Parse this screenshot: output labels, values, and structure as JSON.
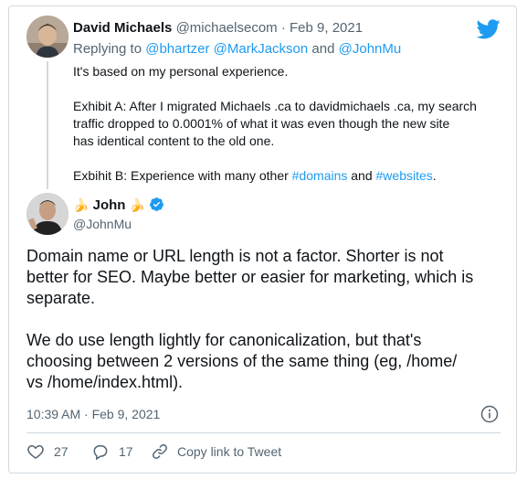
{
  "reply": {
    "author_name": "David Michaels",
    "handle": "@michaelsecom",
    "separator": "·",
    "date": "Feb 9, 2021",
    "replying_prefix": "Replying to",
    "replying_to_1": "@bhartzer",
    "replying_to_2": "@MarkJackson",
    "replying_and": "and",
    "replying_to_3": "@JohnMu",
    "line1": "It's based on my personal experience.",
    "line2": "Exhibit A: After I migrated Michaels .ca to davidmichaels .ca, my search",
    "line3": "traffic dropped to 0.0001% of what it was even though the new site",
    "line4": "has identical content to the old one.",
    "line5_prefix": "Exbihit B: Experience with many other",
    "hashtag_1": "#domains",
    "line5_and": "and",
    "hashtag_2": "#websites",
    "line5_suffix": "."
  },
  "main": {
    "author_name": "John",
    "handle": "@JohnMu",
    "body_line1": "Domain name or URL length is not a factor. Shorter is not",
    "body_line2": "better for SEO. Maybe better or easier for marketing, which is",
    "body_line3": "separate.",
    "body_line4": "We do use length lightly for canonicalization, but that's",
    "body_line5": "choosing between 2 versions of the same thing (eg, /home/",
    "body_line6": "vs /home/index.html).",
    "timestamp": "10:39 AM · Feb 9, 2021"
  },
  "actions": {
    "like_count": "27",
    "reply_count": "17",
    "copy_link_label": "Copy link to Tweet"
  },
  "colors": {
    "accent": "#1d9bf0",
    "text": "#0f1419",
    "muted": "#536471",
    "border": "#cfd9de"
  }
}
